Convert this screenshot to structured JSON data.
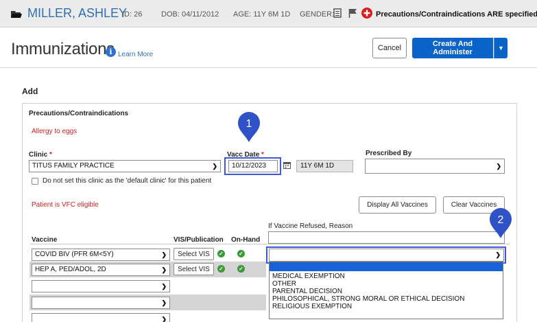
{
  "patient": {
    "name": "MILLER, ASHLEY",
    "id": "ID: 26",
    "dob": "DOB: 04/11/2012",
    "age": "AGE: 11Y 6M 1D",
    "gender": "GENDER: F",
    "precautions_alert": "Precautions/Contraindications ARE specified"
  },
  "page": {
    "title": "Immunizations",
    "learn_more": "Learn More",
    "cancel_label": "Cancel",
    "create_label": "Create And Administer"
  },
  "form": {
    "section_title": "Add",
    "precautions_label": "Precautions/Contraindications",
    "allergy_text": "Allergy to eggs",
    "clinic_label": "Clinic",
    "clinic_value": "TITUS FAMILY PRACTICE",
    "vacc_date_label": "Vacc Date",
    "vacc_date_value": "10/12/2023",
    "age_value": "11Y 6M 1D",
    "prescribed_by_label": "Prescribed By",
    "prescribed_by_value": "",
    "default_clinic_text": "Do not set this clinic as the 'default clinic' for this patient",
    "vfc_text": "Patient is VFC eligible",
    "display_all_label": "Display All Vaccines",
    "clear_vaccines_label": "Clear Vaccines",
    "refused_reason_label": "If Vaccine Refused, Reason",
    "required_marker": "*"
  },
  "table": {
    "headers": {
      "vaccine": "Vaccine",
      "vis": "VIS/Publication",
      "on_hand": "On-Hand"
    },
    "rows": [
      {
        "vaccine": "COVID BIV (PFR 6M<5Y)",
        "vis_label": "Select VIS"
      },
      {
        "vaccine": "HEP A, PED/ADOL, 2D",
        "vis_label": "Select VIS"
      },
      {
        "vaccine": "",
        "vis_label": ""
      },
      {
        "vaccine": "",
        "vis_label": ""
      },
      {
        "vaccine": "",
        "vis_label": ""
      }
    ]
  },
  "refusal_dropdown": {
    "selected": "",
    "options": [
      "",
      "MEDICAL EXEMPTION",
      "OTHER",
      "PARENTAL DECISION",
      "PHILOSOPHICAL, STRONG MORAL OR ETHICAL DECISION",
      "RELIGIOUS EXEMPTION"
    ]
  },
  "markers": {
    "one": "1",
    "two": "2"
  },
  "colors": {
    "link_blue": "#2f6fb1",
    "primary_button": "#0a63c9",
    "highlight": "#3b5bd6",
    "alert_red": "#d42020",
    "ok_green": "#3c9a3c"
  },
  "icons": {
    "folder": "folder-icon",
    "notes": "notes-icon",
    "flag": "flag-icon",
    "alert": "alert-plus-icon",
    "info": "info-icon",
    "calendar": "calendar-icon",
    "check": "check-circle-icon",
    "caret": "chevron-down-icon"
  }
}
